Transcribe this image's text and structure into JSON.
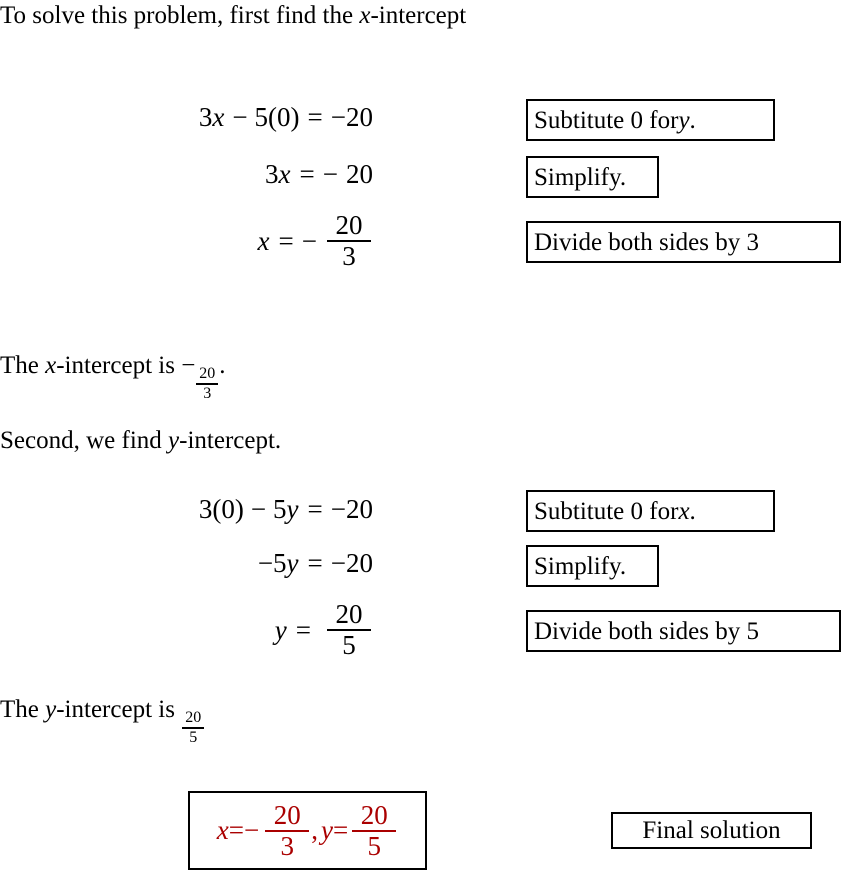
{
  "document": {
    "type": "math-worked-solution",
    "topic": "Finding x- and y-intercepts of 3x - 5y = -20"
  },
  "intro": {
    "text_before": "To solve this problem, first find the ",
    "variable": "x",
    "text_after": "-intercept"
  },
  "step_block_1": {
    "equations": [
      {
        "id": "eq1",
        "latex": "3x - 5(0) = -20",
        "lhs": "3x − 5(0)",
        "rhs": "−20",
        "parts": {
          "coef": "3",
          "var": "x",
          "minus": "−",
          "term": "5(0)",
          "equals": "=",
          "result": "−20"
        }
      },
      {
        "id": "eq2",
        "latex": "3x = -20",
        "parts": {
          "coef": "3",
          "var": "x",
          "equals": "=",
          "minus": "−",
          "result": "20"
        }
      },
      {
        "id": "eq3",
        "latex": "x = -\\frac{20}{3}",
        "parts": {
          "var": "x",
          "equals": "=",
          "minus": "−",
          "numerator": "20",
          "denominator": "3"
        }
      }
    ],
    "annotations": [
      {
        "id": "ann1",
        "text_before": "Subtitute 0 for ",
        "variable": "y",
        "text_after": "."
      },
      {
        "id": "ann2",
        "text": "Simplify."
      },
      {
        "id": "ann3",
        "text": "Divide both sides by 3"
      }
    ]
  },
  "x_intercept_statement": {
    "text_before": "The ",
    "variable": "x",
    "text_middle": "-intercept is ",
    "sign": "−",
    "numerator": "20",
    "denominator": "3",
    "text_after": "."
  },
  "second_lead_in": {
    "text_before": "Second, we find ",
    "variable": "y",
    "text_after": "-intercept."
  },
  "step_block_2": {
    "equations": [
      {
        "id": "eq4",
        "latex": "3(0) - 5y = -20",
        "parts": {
          "term1": "3(0)",
          "minus": "−",
          "coef": "5",
          "var": "y",
          "equals": "=",
          "result": "−20"
        }
      },
      {
        "id": "eq5",
        "latex": "-5y = -20",
        "parts": {
          "minus": "−",
          "coef": "5",
          "var": "y",
          "equals": "=",
          "result": "−20"
        }
      },
      {
        "id": "eq6",
        "latex": "y = \\frac{20}{5}",
        "parts": {
          "var": "y",
          "equals": "=",
          "numerator": "20",
          "denominator": "5"
        }
      }
    ],
    "annotations": [
      {
        "id": "ann4",
        "text_before": "Subtitute 0 for ",
        "variable": "x",
        "text_after": "."
      },
      {
        "id": "ann5",
        "text": "Simplify."
      },
      {
        "id": "ann6",
        "text": "Divide both sides by 5"
      }
    ]
  },
  "y_intercept_statement": {
    "text_before": "The ",
    "variable": "y",
    "text_middle": "-intercept is ",
    "numerator": "20",
    "denominator": "5"
  },
  "final_answer": {
    "color": "#AA0000",
    "border_color": "#000000",
    "x_var": "x",
    "x_equals": "=",
    "x_sign": "−",
    "x_numerator": "20",
    "x_denominator": "3",
    "separator": ",",
    "y_var": "y",
    "y_equals": "=",
    "y_numerator": "20",
    "y_denominator": "5"
  },
  "final_label": {
    "text": "Final solution"
  }
}
